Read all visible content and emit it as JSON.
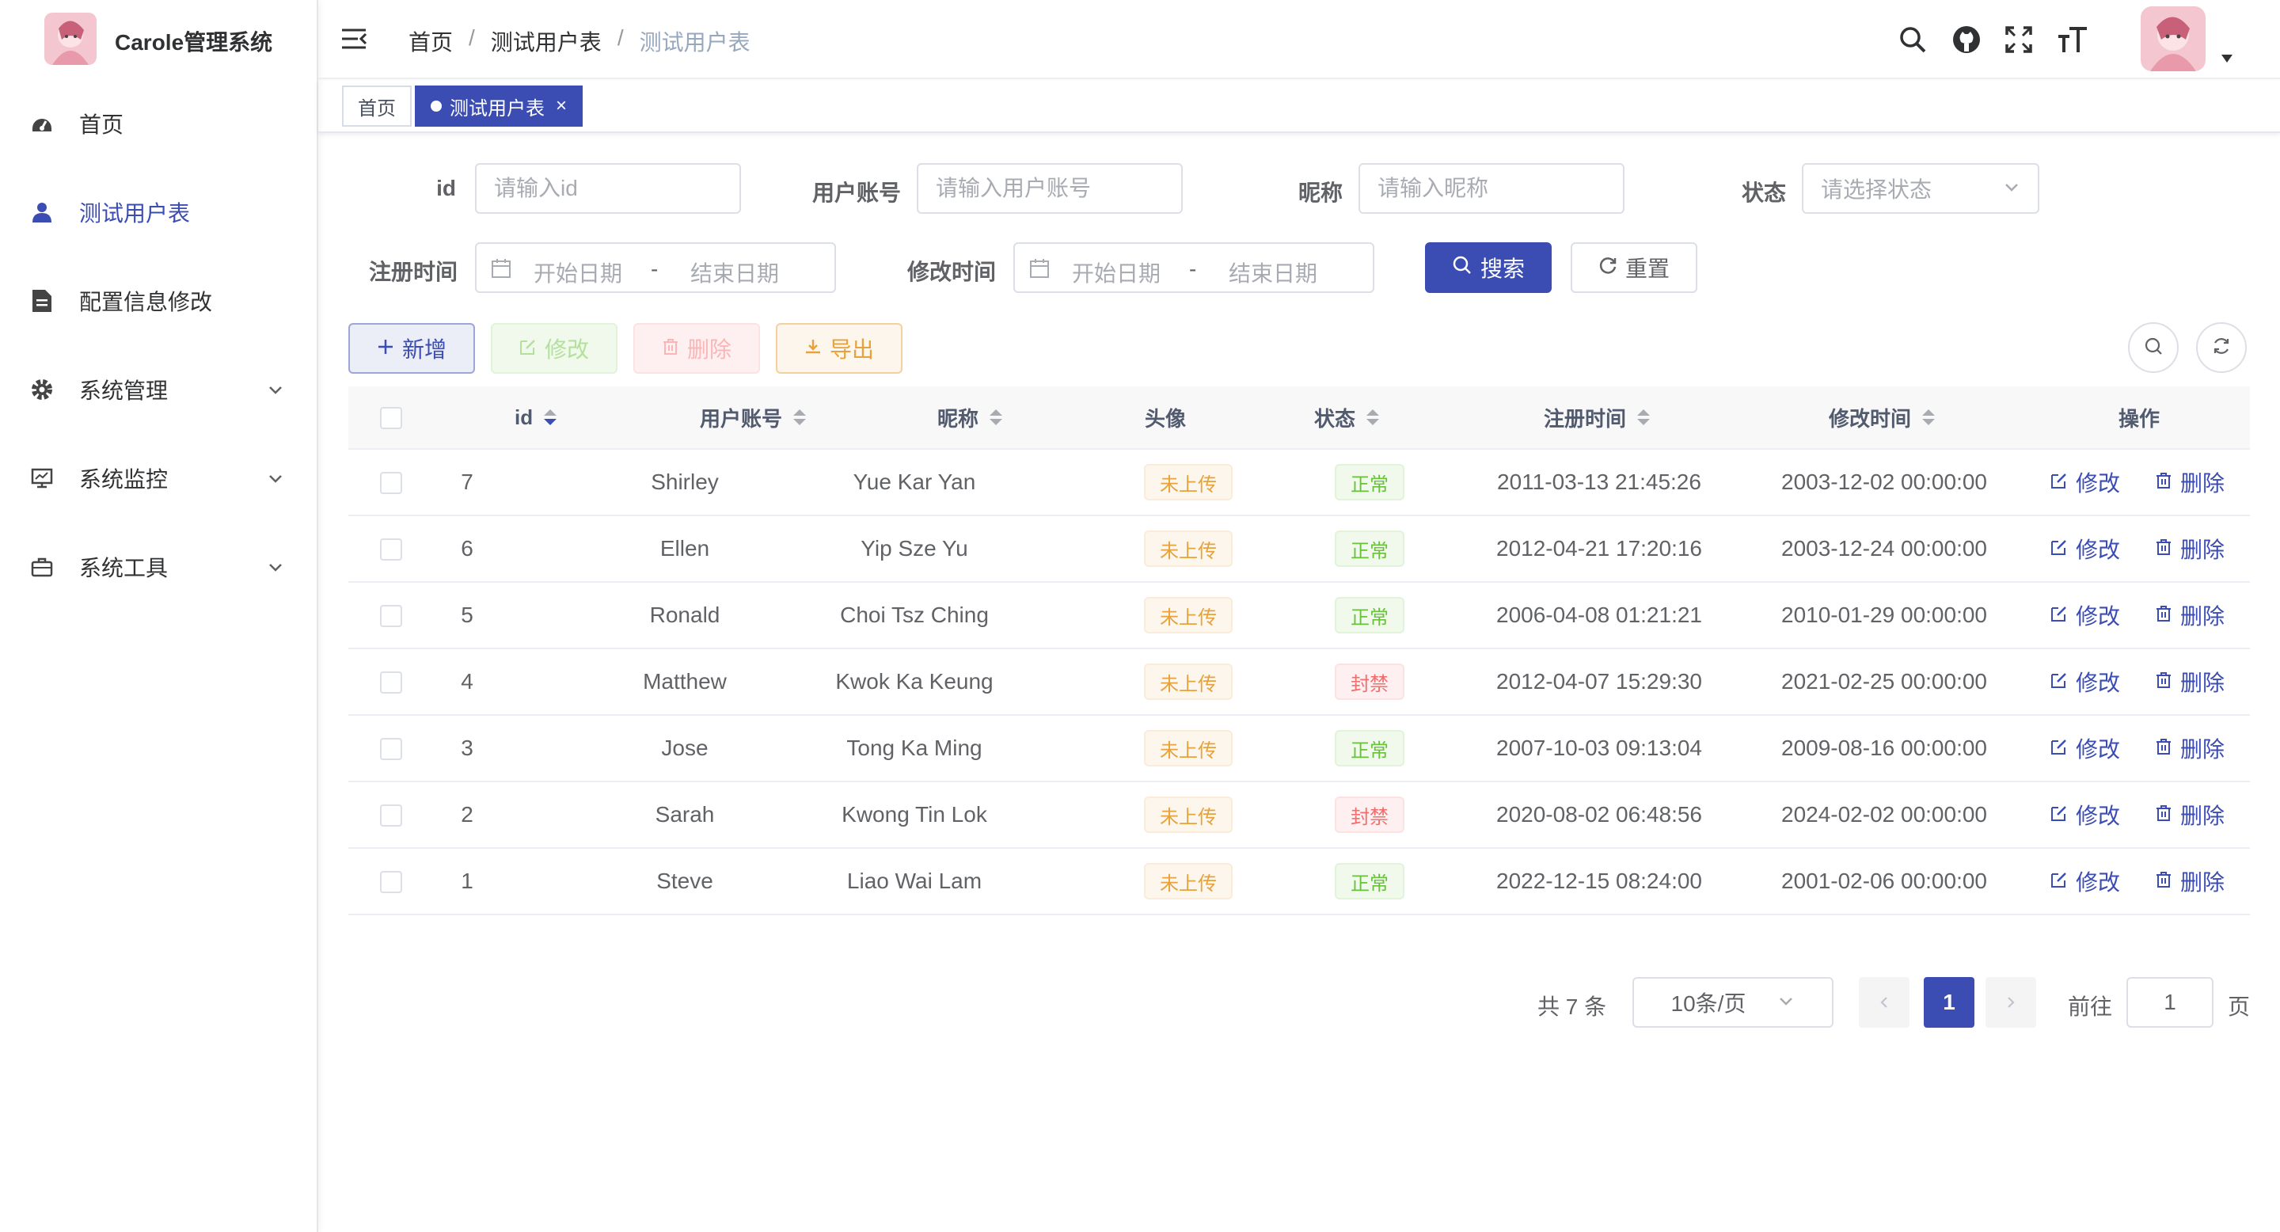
{
  "app": {
    "title": "Carole管理系统"
  },
  "sidebar": {
    "items": [
      {
        "label": "首页",
        "icon": "dashboard-icon"
      },
      {
        "label": "测试用户表",
        "icon": "user-icon"
      },
      {
        "label": "配置信息修改",
        "icon": "document-icon"
      },
      {
        "label": "系统管理",
        "icon": "gear-icon"
      },
      {
        "label": "系统监控",
        "icon": "monitor-icon"
      },
      {
        "label": "系统工具",
        "icon": "toolbox-icon"
      }
    ]
  },
  "header": {
    "breadcrumb": [
      "首页",
      "测试用户表",
      "测试用户表"
    ]
  },
  "tags": {
    "home": "首页",
    "current": "测试用户表"
  },
  "search": {
    "id_label": "id",
    "id_placeholder": "请输入id",
    "account_label": "用户账号",
    "account_placeholder": "请输入用户账号",
    "nickname_label": "昵称",
    "nickname_placeholder": "请输入昵称",
    "status_label": "状态",
    "status_placeholder": "请选择状态",
    "register_label": "注册时间",
    "modify_label": "修改时间",
    "start_date": "开始日期",
    "date_sep": "-",
    "end_date": "结束日期",
    "search_btn": "搜索",
    "reset_btn": "重置"
  },
  "toolbar": {
    "add": "新增",
    "edit": "修改",
    "delete": "删除",
    "export": "导出"
  },
  "table": {
    "columns": [
      "id",
      "用户账号",
      "昵称",
      "头像",
      "状态",
      "注册时间",
      "修改时间",
      "操作"
    ],
    "rows": [
      {
        "id": "7",
        "account": "Shirley",
        "nickname": "Yue Kar Yan",
        "avatar": "未上传",
        "status": "正常",
        "status_type": "ok",
        "registered": "2011-03-13 21:45:26",
        "modified": "2003-12-02 00:00:00"
      },
      {
        "id": "6",
        "account": "Ellen",
        "nickname": "Yip Sze Yu",
        "avatar": "未上传",
        "status": "正常",
        "status_type": "ok",
        "registered": "2012-04-21 17:20:16",
        "modified": "2003-12-24 00:00:00"
      },
      {
        "id": "5",
        "account": "Ronald",
        "nickname": "Choi Tsz Ching",
        "avatar": "未上传",
        "status": "正常",
        "status_type": "ok",
        "registered": "2006-04-08 01:21:21",
        "modified": "2010-01-29 00:00:00"
      },
      {
        "id": "4",
        "account": "Matthew",
        "nickname": "Kwok Ka Keung",
        "avatar": "未上传",
        "status": "封禁",
        "status_type": "bad",
        "registered": "2012-04-07 15:29:30",
        "modified": "2021-02-25 00:00:00"
      },
      {
        "id": "3",
        "account": "Jose",
        "nickname": "Tong Ka Ming",
        "avatar": "未上传",
        "status": "正常",
        "status_type": "ok",
        "registered": "2007-10-03 09:13:04",
        "modified": "2009-08-16 00:00:00"
      },
      {
        "id": "2",
        "account": "Sarah",
        "nickname": "Kwong Tin Lok",
        "avatar": "未上传",
        "status": "封禁",
        "status_type": "bad",
        "registered": "2020-08-02 06:48:56",
        "modified": "2024-02-02 00:00:00"
      },
      {
        "id": "1",
        "account": "Steve",
        "nickname": "Liao Wai Lam",
        "avatar": "未上传",
        "status": "正常",
        "status_type": "ok",
        "registered": "2022-12-15 08:24:00",
        "modified": "2001-02-06 00:00:00"
      }
    ],
    "row_edit": "修改",
    "row_delete": "删除"
  },
  "pagination": {
    "total": "共 7 条",
    "page_size": "10条/页",
    "current_page": "1",
    "goto_label": "前往",
    "goto_value": "1",
    "goto_suffix": "页"
  },
  "colors": {
    "primary": "#3b4db3"
  }
}
